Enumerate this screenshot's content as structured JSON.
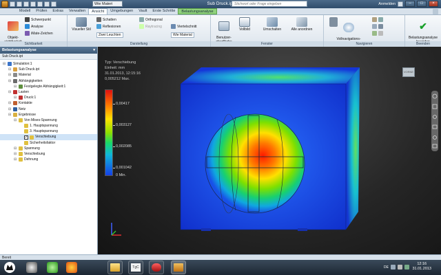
{
  "window": {
    "title": "Sub Druck.ipt",
    "workspace_combo": "Wie Materi",
    "search_placeholder": "Stichwort oder Frage eingeben",
    "signin": "Anmelden"
  },
  "tabs": [
    "Modell",
    "Prüfen",
    "Extras",
    "Verwalten",
    "Ansicht",
    "Umgebungen",
    "Vault",
    "Erste Schritte",
    "Belastungsanalyse"
  ],
  "active_tab": "Ansicht",
  "ribbon": {
    "sichtbarkeit": {
      "label": "Sichtbarkeit",
      "objekt": "Objekt-\nsichtbarkeit",
      "schwerpunkt": "Schwerpunkt",
      "analyse": "Analyse",
      "imate": "iMate-Zeichen"
    },
    "darstellung": {
      "label": "Darstellung",
      "visueller_stil": "Visueller Stil",
      "schatten": "Schatten",
      "reflexionen": "Reflexionen",
      "zwei_leuchten": "Zwei Leuchten",
      "orthogonal": "Orthogonal",
      "raytracing": "Raytracing",
      "viertelschnitt": "Viertelschnitt",
      "wie_material": "Wie Material"
    },
    "fenster": {
      "label": "Fenster",
      "benutzeroberflaeche": "Benutzer-\noberfläche",
      "vollbild": "Vollbild",
      "umschalten": "Umschalten",
      "alle_anordnen": "Alle anordnen"
    },
    "navigieren": {
      "label": "Navigieren",
      "vollnavigationsrad": "Vollnavigations-\nRad"
    },
    "beenden": {
      "label": "Beenden",
      "belastungsanalyse_beenden": "Belastungsanalyse\nbeenden"
    }
  },
  "browser": {
    "title": "Belastungsanalyse",
    "doc": "Sub Druck.ipt",
    "nodes": [
      {
        "label": "Simulation:1",
        "indent": 0,
        "color": "#3b74c9"
      },
      {
        "label": "Sub Druck.ipt",
        "indent": 1,
        "color": "#d9a040"
      },
      {
        "label": "Material",
        "indent": 1,
        "color": "#8a8a8a"
      },
      {
        "label": "Abhängigkeiten",
        "indent": 1,
        "color": "#6b6b6b"
      },
      {
        "label": "Festgelegte Abhängigkeit:1",
        "indent": 2,
        "color": "#5f8f3f"
      },
      {
        "label": "Lasten",
        "indent": 1,
        "color": "#c03030"
      },
      {
        "label": "Druck:1",
        "indent": 2,
        "color": "#c03030"
      },
      {
        "label": "Kontakte",
        "indent": 1,
        "color": "#c06030"
      },
      {
        "label": "Netz",
        "indent": 1,
        "color": "#3060a0"
      },
      {
        "label": "Ergebnisse",
        "indent": 1,
        "color": "#d9b040"
      },
      {
        "label": "Von Mises-Spannung",
        "indent": 2,
        "color": "#e0c040"
      },
      {
        "label": "1. Hauptspannung",
        "indent": 3,
        "color": "#e0c040"
      },
      {
        "label": "3. Hauptspannung",
        "indent": 3,
        "color": "#e0c040"
      },
      {
        "label": "Verschiebung",
        "indent": 3,
        "color": "#e0c040",
        "checked": true,
        "selected": true
      },
      {
        "label": "Sicherheitsfaktor",
        "indent": 3,
        "color": "#e0c040"
      },
      {
        "label": "Spannung",
        "indent": 2,
        "color": "#e0c040"
      },
      {
        "label": "Verschiebung",
        "indent": 2,
        "color": "#e0c040"
      },
      {
        "label": "Dehnung",
        "indent": 2,
        "color": "#e0c040"
      }
    ]
  },
  "viewport": {
    "typ": "Typ: Verschiebung",
    "einheit": "Einheit: mm",
    "datum": "31.01.2013, 12:15:16",
    "max": "0,005212 Max.",
    "legend_values": [
      "0,00417",
      "0,003127",
      "0,002085",
      "0,001042",
      "0 Min."
    ],
    "viewcube_label": "VORNE"
  },
  "status": "Bereit",
  "taskbar": {
    "lang": "DE",
    "time": "12:16",
    "date": "31.01.2013"
  }
}
